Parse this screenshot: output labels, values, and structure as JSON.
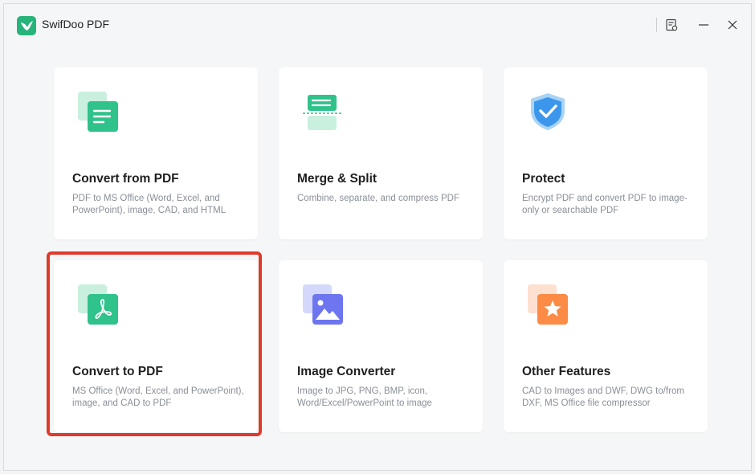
{
  "app": {
    "title": "SwifDoo PDF",
    "logo_icon": "swift-bird-icon",
    "brand_color": "#27b47a"
  },
  "titlebar": {
    "buttons": [
      {
        "name": "feedback-icon"
      },
      {
        "name": "minimize-icon"
      },
      {
        "name": "close-icon"
      }
    ]
  },
  "cards": [
    {
      "title": "Convert from PDF",
      "description": "PDF to MS Office (Word, Excel, and PowerPoint), image, CAD, and HTML",
      "icon": "document-lines-icon"
    },
    {
      "title": "Merge & Split",
      "description": "Combine, separate, and compress PDF",
      "icon": "merge-split-icon"
    },
    {
      "title": "Protect",
      "description": "Encrypt PDF and convert PDF to image-only or searchable PDF",
      "icon": "shield-check-icon"
    },
    {
      "title": "Convert to PDF",
      "description": "MS Office (Word, Excel, and PowerPoint), image, and CAD to PDF",
      "icon": "pdf-symbol-icon"
    },
    {
      "title": "Image Converter",
      "description": "Image to JPG, PNG, BMP, icon, Word/Excel/PowerPoint to image",
      "icon": "image-icon"
    },
    {
      "title": "Other Features",
      "description": "CAD to Images and DWF, DWG to/from DXF, MS Office file compressor",
      "icon": "star-icon"
    }
  ],
  "highlight_color": "#e03a2b"
}
